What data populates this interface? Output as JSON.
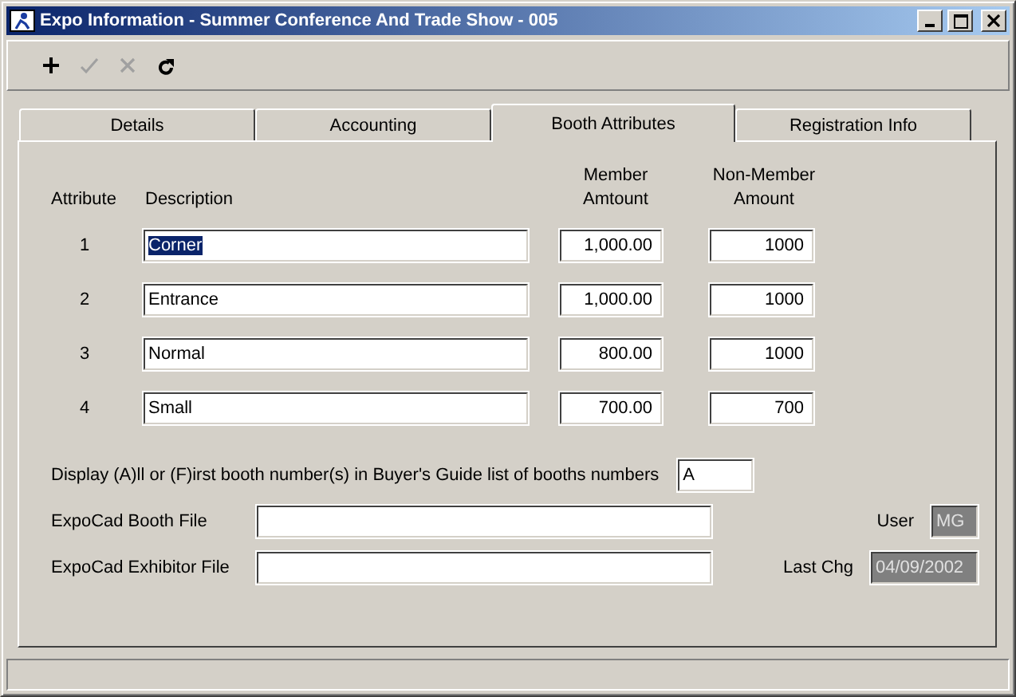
{
  "window": {
    "title": "Expo Information - Summer Conference And Trade Show - 005"
  },
  "toolbar": [
    {
      "kind": "plus",
      "disabled": false
    },
    {
      "kind": "check",
      "disabled": true
    },
    {
      "kind": "cross",
      "disabled": true
    },
    {
      "kind": "redo",
      "disabled": false
    }
  ],
  "tabs": [
    {
      "label": "Details",
      "selected": false
    },
    {
      "label": "Accounting",
      "selected": false
    },
    {
      "label": "Booth Attributes",
      "selected": true
    },
    {
      "label": "Registration Info",
      "selected": false
    }
  ],
  "columns": [
    "Attribute",
    "Description",
    "Member Amtount",
    "Non-Member Amount"
  ],
  "rows": [
    {
      "attribute": "1",
      "description": "Corner",
      "text_selected": true,
      "member": "1,000.00",
      "non_member": "1000"
    },
    {
      "attribute": "2",
      "description": "Entrance",
      "text_selected": false,
      "member": "1,000.00",
      "non_member": "1000"
    },
    {
      "attribute": "3",
      "description": "Normal",
      "text_selected": false,
      "member": "800.00",
      "non_member": "1000"
    },
    {
      "attribute": "4",
      "description": "Small",
      "text_selected": false,
      "member": "700.00",
      "non_member": "700"
    }
  ],
  "display_option": {
    "label": "Display (A)ll or (F)irst booth number(s) in Buyer's Guide list of booths numbers",
    "value": "A"
  },
  "booth_file": {
    "label": "ExpoCad Booth File"
  },
  "exhibitor_file": {
    "label": "ExpoCad Exhibitor File"
  },
  "user": {
    "label": "User",
    "value": "MG",
    "disabled": true
  },
  "last_change": {
    "label": "Last Chg",
    "value": "04/09/2002",
    "disabled": true
  }
}
